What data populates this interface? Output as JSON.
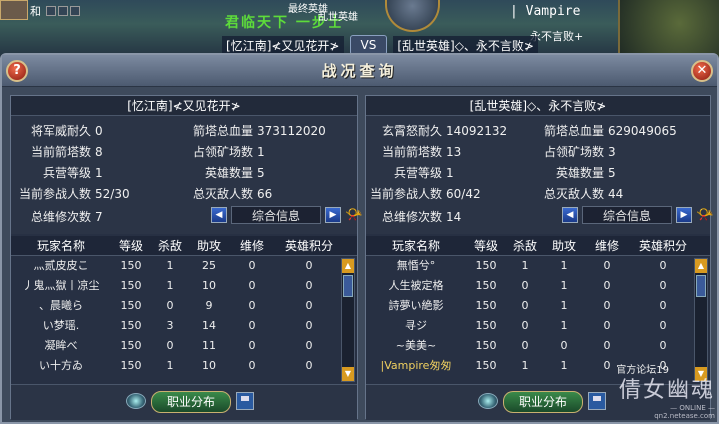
{
  "scene": {
    "player_name": "和",
    "green_text": "君临天下 一步士",
    "top_name_a": "最终英雄",
    "top_name_b": "乱世英雄",
    "right_text": "| Vampire",
    "right_text_b": "永不言败+",
    "versus_left": "[忆江南]≮又见花开≯",
    "versus_mid": "VS",
    "versus_right": "[乱世英雄]◇、永不言败≯"
  },
  "window": {
    "title": "战况查询",
    "help": "?",
    "close": "✕"
  },
  "left": {
    "head": "[忆江南]≮又见花开≯",
    "stats": {
      "defense_label": "将军威耐久",
      "defense": "0",
      "tower_hp_label": "箭塔总血量",
      "tower_hp": "373112020",
      "cur_towers_label": "当前箭塔数",
      "cur_towers": "8",
      "mines_label": "占领矿场数",
      "mines": "1",
      "barracks_label": "兵营等级",
      "barracks": "1",
      "heroes_label": "英雄数量",
      "heroes": "5",
      "players_label": "当前参战人数",
      "players": "52/30",
      "kills_label": "总灭敌人数",
      "kills": "66",
      "repairs_label": "总维修次数",
      "repairs": "7"
    },
    "tab": "综合信息",
    "columns": [
      "玩家名称",
      "等级",
      "杀敌",
      "助攻",
      "维修",
      "英雄积分"
    ],
    "rows": [
      [
        "灬贰皮皮こ",
        "150",
        "1",
        "25",
        "0",
        "0"
      ],
      [
        "丿鬼灬獄丨凉尘",
        "150",
        "1",
        "10",
        "0",
        "0"
      ],
      [
        "、晨曦ら",
        "150",
        "0",
        "9",
        "0",
        "0"
      ],
      [
        "い梦瑶.",
        "150",
        "3",
        "14",
        "0",
        "0"
      ],
      [
        "凝眸べ",
        "150",
        "0",
        "11",
        "0",
        "0"
      ],
      [
        "い十方ゐ",
        "150",
        "1",
        "10",
        "0",
        "0"
      ]
    ],
    "job_button": "职业分布"
  },
  "right": {
    "head": "[乱世英雄]◇、永不言败≯",
    "stats": {
      "defense_label": "玄霄怒耐久",
      "defense": "14092132",
      "tower_hp_label": "箭塔总血量",
      "tower_hp": "629049065",
      "cur_towers_label": "当前箭塔数",
      "cur_towers": "13",
      "mines_label": "占领矿场数",
      "mines": "3",
      "barracks_label": "兵营等级",
      "barracks": "1",
      "heroes_label": "英雄数量",
      "heroes": "5",
      "players_label": "当前参战人数",
      "players": "60/42",
      "kills_label": "总灭敌人数",
      "kills": "44",
      "repairs_label": "总维修次数",
      "repairs": "14"
    },
    "tab": "综合信息",
    "columns": [
      "玩家名称",
      "等级",
      "杀敌",
      "助攻",
      "维修",
      "英雄积分"
    ],
    "rows": [
      [
        "無惛兮°",
        "150",
        "1",
        "1",
        "0",
        "0"
      ],
      [
        "人生被定格",
        "150",
        "0",
        "1",
        "0",
        "0"
      ],
      [
        "詩夢い絶影",
        "150",
        "0",
        "1",
        "0",
        "0"
      ],
      [
        "寻ジ",
        "150",
        "0",
        "1",
        "0",
        "0"
      ],
      [
        "~美美~",
        "150",
        "0",
        "0",
        "0",
        "0"
      ],
      [
        "|Vampire匆匆",
        "150",
        "1",
        "1",
        "0",
        "0"
      ]
    ],
    "job_button": "职业分布"
  },
  "watermark": {
    "forum": "官方论坛",
    "forum_num": "19",
    "logo": "倩女幽魂",
    "sub": "— ONLINE —",
    "url": "qn2.netease.com"
  }
}
